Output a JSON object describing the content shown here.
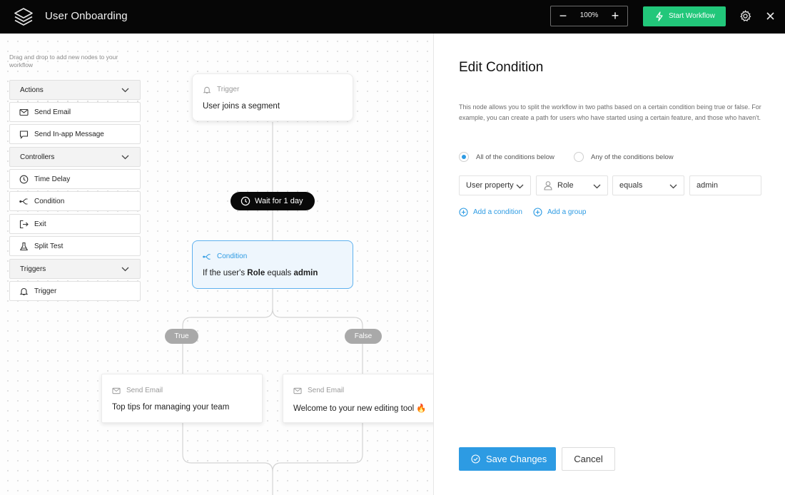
{
  "header": {
    "title": "User Onboarding",
    "zoom": {
      "minus": "−",
      "value": "100%",
      "plus": "+"
    },
    "start_button": "Start Workflow"
  },
  "palette": {
    "hint": "Drag and drop to add new nodes to your workflow",
    "groups": [
      {
        "label": "Actions",
        "items": [
          {
            "label": "Send Email",
            "icon": "mail-icon"
          },
          {
            "label": "Send In-app Message",
            "icon": "message-icon"
          }
        ]
      },
      {
        "label": "Controllers",
        "items": [
          {
            "label": "Time Delay",
            "icon": "clock-icon"
          },
          {
            "label": "Condition",
            "icon": "branch-icon"
          },
          {
            "label": "Exit",
            "icon": "exit-icon"
          },
          {
            "label": "Split Test",
            "icon": "flask-icon"
          }
        ]
      },
      {
        "label": "Triggers",
        "items": [
          {
            "label": "Trigger",
            "icon": "bell-icon"
          }
        ]
      }
    ]
  },
  "flow": {
    "trigger": {
      "type": "Trigger",
      "text": "User joins a segment"
    },
    "wait": "Wait for 1 day",
    "condition": {
      "type": "Condition",
      "prefix": "If the user's",
      "field": "Role",
      "op": "equals",
      "value": "admin"
    },
    "true_label": "True",
    "false_label": "False",
    "email_true": {
      "type": "Send Email",
      "text": "Top tips for managing your team"
    },
    "email_false": {
      "type": "Send Email",
      "text": "Welcome to your new editing tool 🔥"
    }
  },
  "panel": {
    "title": "Edit Condition",
    "description": "This node allows you to split the workflow in two paths based on a certain condition being true or false. For example, you can create a path for users who have started using a certain feature, and those who haven't.",
    "match_all": "All of the conditions below",
    "match_any": "Any of the conditions below",
    "selected_match": "all",
    "rule": {
      "source": "User property",
      "property": "Role",
      "operator": "equals",
      "value": "admin"
    },
    "add_condition": "Add a condition",
    "add_group": "Add a group",
    "save": "Save Changes",
    "cancel": "Cancel"
  },
  "colors": {
    "accent": "#2d9be3",
    "start_green": "#22c77a",
    "header_bg": "#060606"
  }
}
